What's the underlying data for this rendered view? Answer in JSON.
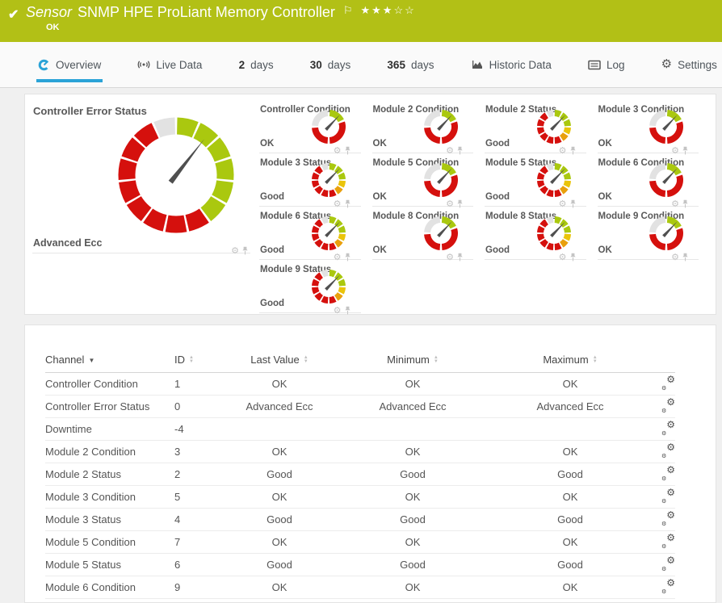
{
  "header": {
    "kind": "Sensor",
    "title": "SNMP HPE ProLiant Memory Controller",
    "status": "OK",
    "check_icon": "✔",
    "flag_icon": "⚐",
    "stars_filled": 3,
    "stars_total": 5
  },
  "tabs": [
    {
      "label": "Overview",
      "icon": "gauge",
      "active": true
    },
    {
      "label": "Live Data",
      "icon": "broadcast",
      "active": false
    },
    {
      "label": "days",
      "prefix": "2",
      "active": false
    },
    {
      "label": "days",
      "prefix": "30",
      "active": false
    },
    {
      "label": "days",
      "prefix": "365",
      "active": false
    },
    {
      "label": "Historic Data",
      "icon": "histchart",
      "active": false
    },
    {
      "label": "Log",
      "icon": "log",
      "active": false
    },
    {
      "label": "Settings",
      "icon": "gear",
      "active": false
    }
  ],
  "gauges": {
    "large": {
      "title": "Controller Error Status",
      "value": "Advanced Ecc",
      "type": "big",
      "needle_deg": 38
    },
    "small": [
      {
        "title": "Controller Condition",
        "value": "OK",
        "type": "condition",
        "needle_deg": 43
      },
      {
        "title": "Module 2 Condition",
        "value": "OK",
        "type": "condition",
        "needle_deg": 43
      },
      {
        "title": "Module 2 Status",
        "value": "Good",
        "type": "status",
        "needle_deg": 44
      },
      {
        "title": "Module 3 Condition",
        "value": "OK",
        "type": "condition",
        "needle_deg": 43
      },
      {
        "title": "Module 3 Status",
        "value": "Good",
        "type": "status",
        "needle_deg": 44
      },
      {
        "title": "Module 5 Condition",
        "value": "OK",
        "type": "condition",
        "needle_deg": 43
      },
      {
        "title": "Module 5 Status",
        "value": "Good",
        "type": "status",
        "needle_deg": 44
      },
      {
        "title": "Module 6 Condition",
        "value": "OK",
        "type": "condition",
        "needle_deg": 43
      },
      {
        "title": "Module 6 Status",
        "value": "Good",
        "type": "status",
        "needle_deg": 44
      },
      {
        "title": "Module 8 Condition",
        "value": "OK",
        "type": "condition",
        "needle_deg": 43
      },
      {
        "title": "Module 8 Status",
        "value": "Good",
        "type": "status",
        "needle_deg": 44
      },
      {
        "title": "Module 9 Condition",
        "value": "OK",
        "type": "condition",
        "needle_deg": 43
      },
      {
        "title": "Module 9 Status",
        "value": "Good",
        "type": "status",
        "needle_deg": 44
      }
    ]
  },
  "table": {
    "columns": [
      "Channel",
      "ID",
      "Last Value",
      "Minimum",
      "Maximum"
    ],
    "sorted_column": "Channel",
    "rows": [
      {
        "channel": "Controller Condition",
        "id": "1",
        "last": "OK",
        "min": "OK",
        "max": "OK"
      },
      {
        "channel": "Controller Error Status",
        "id": "0",
        "last": "Advanced Ecc",
        "min": "Advanced Ecc",
        "max": "Advanced Ecc"
      },
      {
        "channel": "Downtime",
        "id": "-4",
        "last": "",
        "min": "",
        "max": ""
      },
      {
        "channel": "Module 2 Condition",
        "id": "3",
        "last": "OK",
        "min": "OK",
        "max": "OK"
      },
      {
        "channel": "Module 2 Status",
        "id": "2",
        "last": "Good",
        "min": "Good",
        "max": "Good"
      },
      {
        "channel": "Module 3 Condition",
        "id": "5",
        "last": "OK",
        "min": "OK",
        "max": "OK"
      },
      {
        "channel": "Module 3 Status",
        "id": "4",
        "last": "Good",
        "min": "Good",
        "max": "Good"
      },
      {
        "channel": "Module 5 Condition",
        "id": "7",
        "last": "OK",
        "min": "OK",
        "max": "OK"
      },
      {
        "channel": "Module 5 Status",
        "id": "6",
        "last": "Good",
        "min": "Good",
        "max": "Good"
      },
      {
        "channel": "Module 6 Condition",
        "id": "9",
        "last": "OK",
        "min": "OK",
        "max": "OK"
      }
    ]
  },
  "colors": {
    "header_green": "#b2c016",
    "tab_active_blue": "#2ba3d7",
    "gauge_green": "#aac80f",
    "gauge_red": "#d5100d",
    "gauge_yellow": "#eac40a",
    "gauge_amber": "#e9a00d",
    "gauge_gray": "#e2e2e2",
    "needle_gray": "#4f4f4f"
  }
}
